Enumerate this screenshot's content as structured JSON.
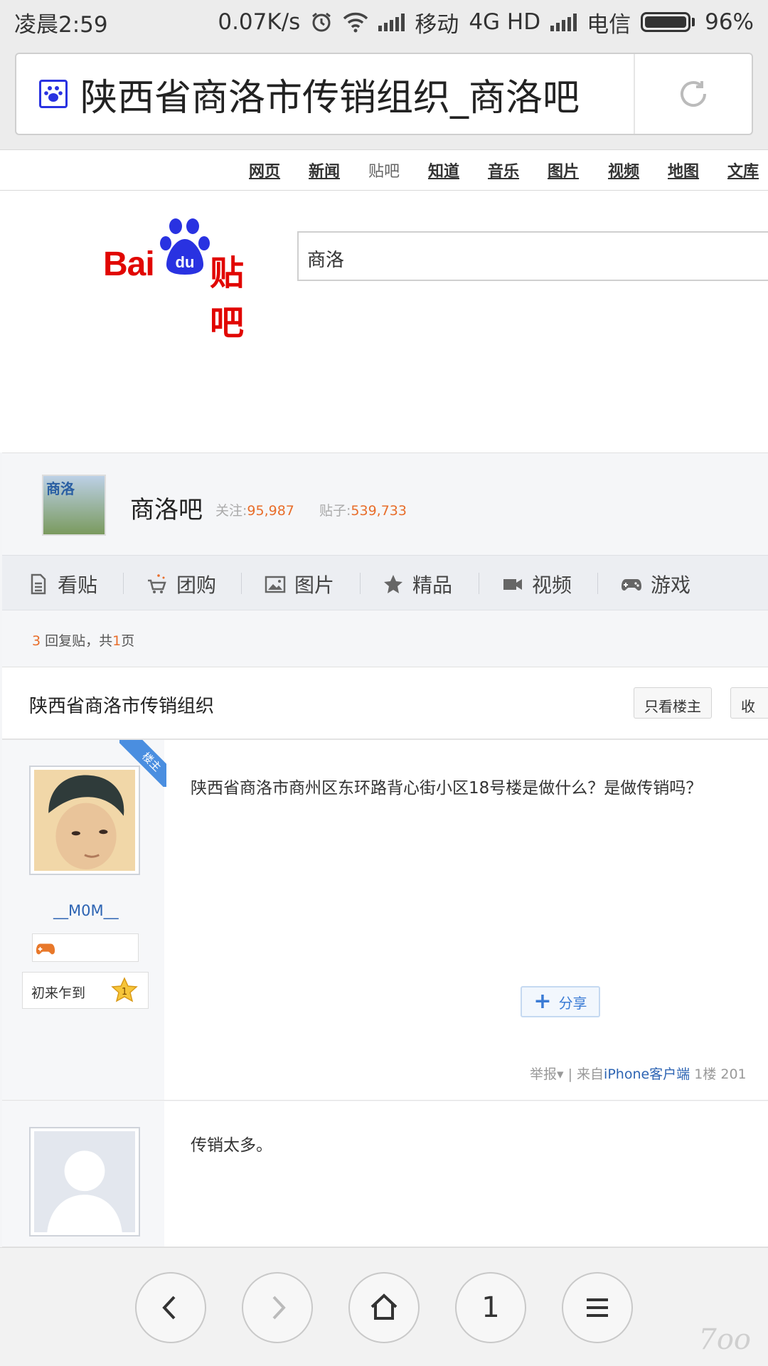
{
  "status_bar": {
    "time": "凌晨2:59",
    "speed": "0.07K/s",
    "carrier1": "移动",
    "network": "4G HD",
    "carrier2": "电信",
    "battery": "96%"
  },
  "address_bar": {
    "title": "陕西省商洛市传销组织_商洛吧"
  },
  "baidu_nav": {
    "items": [
      "网页",
      "新闻",
      "贴吧",
      "知道",
      "音乐",
      "图片",
      "视频",
      "地图",
      "文库"
    ],
    "current": "贴吧"
  },
  "logo": {
    "bai": "Bai",
    "du": "du",
    "tieba": "贴吧"
  },
  "search": {
    "value": "商洛"
  },
  "forum": {
    "avatar_text": "商洛",
    "name": "商洛吧",
    "follow_label": "关注:",
    "follow_count": "95,987",
    "posts_label": "贴子:",
    "posts_count": "539,733"
  },
  "tabs": [
    "看贴",
    "团购",
    "图片",
    "精品",
    "视频",
    "游戏"
  ],
  "reply_info": {
    "count": "3",
    "mid": " 回复贴，共",
    "pages": "1",
    "end": "页"
  },
  "thread": {
    "title": "陕西省商洛市传销组织",
    "only_op": "只看楼主",
    "collect": "收"
  },
  "posts": [
    {
      "landlord_tag": "楼主",
      "username": "__M0M__",
      "level_title": "初来乍到",
      "level": "1",
      "content": "陕西省商洛市商州区东环路背心街小区18号楼是做什么？是做传销吗？",
      "share": "分享",
      "report": "举报▾",
      "from_label": "| 来自",
      "client": "iPhone客户端",
      "floor": "1楼",
      "date": "201"
    },
    {
      "content": "传销太多。"
    }
  ],
  "bottom": {
    "tabs_count": "1",
    "watermark": "7oo"
  }
}
